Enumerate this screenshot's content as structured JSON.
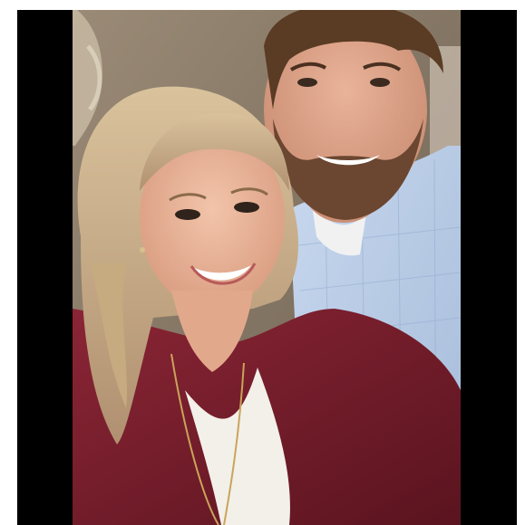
{
  "image": {
    "kind": "photo",
    "subject": "selfie",
    "colors": {
      "frame": "#ffffff",
      "letterbox": "#000000",
      "wall": "#8a7a68",
      "cardigan": "#7b1f2c",
      "shirt": "#b9cde6",
      "hair_blonde": "#cdb48e",
      "hair_dark": "#5a3b24",
      "skin": "#e9b59a"
    }
  }
}
